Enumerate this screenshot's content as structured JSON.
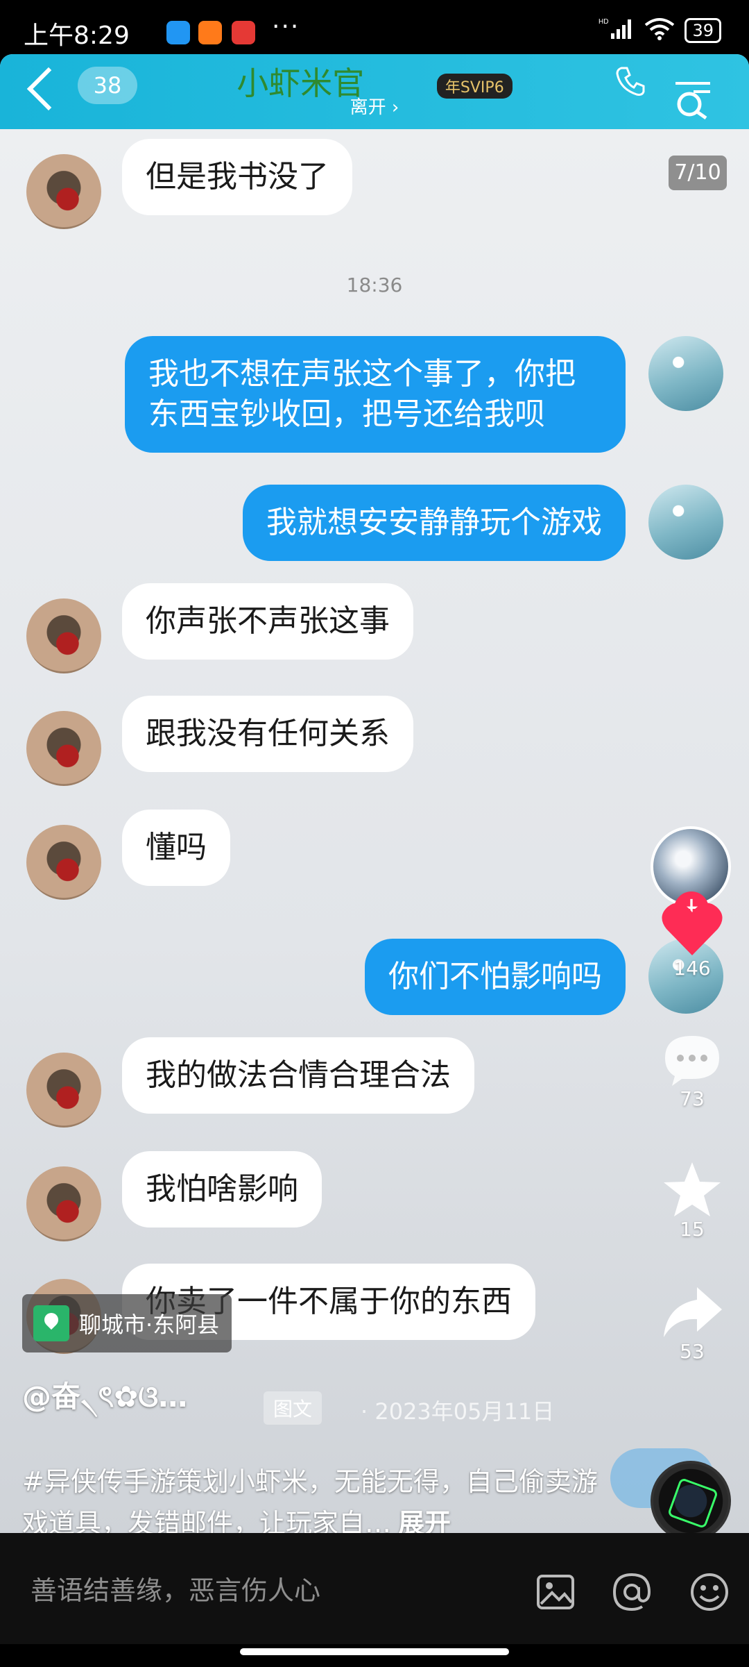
{
  "status_bar": {
    "time": "上午8:29",
    "dots": "···",
    "network": "HD",
    "battery": "39"
  },
  "chat_header": {
    "badge": "38",
    "title": "小虾米官",
    "vip": "年SVIP6",
    "status": "离开 ›"
  },
  "page_counter": "7/10",
  "timestamp": "18:36",
  "messages": [
    {
      "side": "left",
      "text": "但是我书没了"
    },
    {
      "side": "right",
      "line1": "我也不想在声张这个事了，你把",
      "line2": "东西宝钞收回，把号还给我呗"
    },
    {
      "side": "right",
      "text": "我就想安安静静玩个游戏"
    },
    {
      "side": "left",
      "text": "你声张不声张这事"
    },
    {
      "side": "left",
      "text": "跟我没有任何关系"
    },
    {
      "side": "left",
      "text": "懂吗"
    },
    {
      "side": "right",
      "text": "你们不怕影响吗"
    },
    {
      "side": "left",
      "text": "我的做法合情合理合法"
    },
    {
      "side": "left",
      "text": "我怕啥影响"
    },
    {
      "side": "left",
      "text": "你卖了一件不属于你的东西"
    }
  ],
  "rail": {
    "likes": "146",
    "comments": "73",
    "favorites": "15",
    "shares": "53",
    "follow": "+"
  },
  "location": "聊城市·东阿县",
  "author": "@奋৲ৎ✿ଓ…",
  "post_type": "图文",
  "post_date": "· 2023年05月11日",
  "caption": "#异侠传手游策划小虾米，无能无得，自己偷卖游戏道具，发错邮件，让玩家自…",
  "expand_label": "展开",
  "progress": {
    "total": 10,
    "current": 7
  },
  "comment_bar": {
    "placeholder": "善语结善缘，恶言伤人心"
  },
  "colors": {
    "header": "#19b4d9",
    "bubble_right": "#1b9cf0",
    "like": "#fe2c55"
  }
}
